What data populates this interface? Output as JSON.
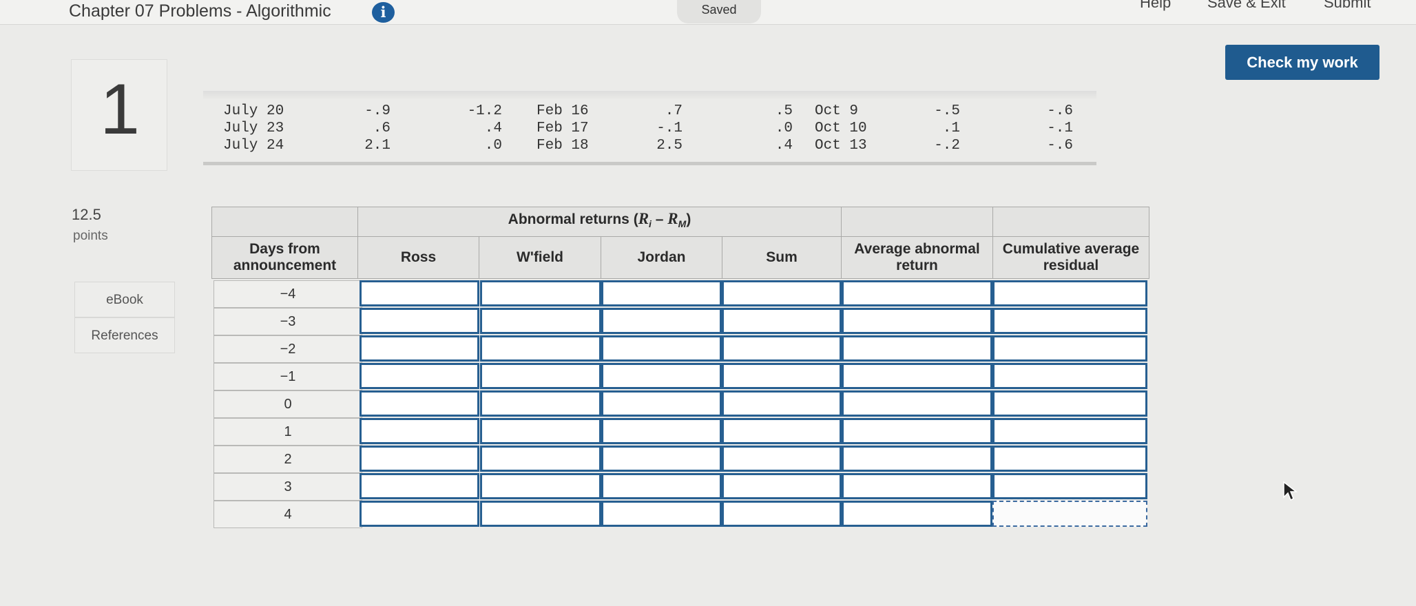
{
  "topbar": {
    "title": "Chapter 07 Problems - Algorithmic",
    "info_icon": "i",
    "saved": "Saved",
    "help": "Help",
    "save_exit": "Save & Exit",
    "submit": "Submit"
  },
  "check_my_work": "Check my work",
  "question": {
    "number": "1",
    "points_value": "12.5",
    "points_label": "points",
    "ebook": "eBook",
    "references": "References"
  },
  "data_rows": [
    {
      "d1": "July 20",
      "r1": "-.9",
      "r2": "-1.2",
      "d2": "Feb 16",
      "r3": ".7",
      "r4": ".5",
      "d3": "Oct 9",
      "r5": "-.5",
      "r6": "-.6"
    },
    {
      "d1": "July 23",
      "r1": ".6",
      "r2": ".4",
      "d2": "Feb 17",
      "r3": "-.1",
      "r4": ".0",
      "d3": "Oct 10",
      "r5": ".1",
      "r6": "-.1"
    },
    {
      "d1": "July 24",
      "r1": "2.1",
      "r2": ".0",
      "d2": "Feb 18",
      "r3": "2.5",
      "r4": ".4",
      "d3": "Oct 13",
      "r5": "-.2",
      "r6": "-.6"
    }
  ],
  "grid": {
    "group_header_prefix": "Abnormal returns (",
    "group_header_r1": "R",
    "group_header_sub1": "i",
    "group_header_mid": " – ",
    "group_header_r2": "R",
    "group_header_sub2": "M",
    "group_header_suffix": ")",
    "col_days": "Days from announcement",
    "col_ross": "Ross",
    "col_wfield": "W'field",
    "col_jordan": "Jordan",
    "col_sum": "Sum",
    "col_avg": "Average abnormal return",
    "col_cum": "Cumulative average residual",
    "rows": [
      "−4",
      "−3",
      "−2",
      "−1",
      "0",
      "1",
      "2",
      "3",
      "4"
    ]
  },
  "colors": {
    "accent": "#1f5b8f",
    "input_border": "#275f91",
    "info_icon": "#1e5f9e"
  }
}
